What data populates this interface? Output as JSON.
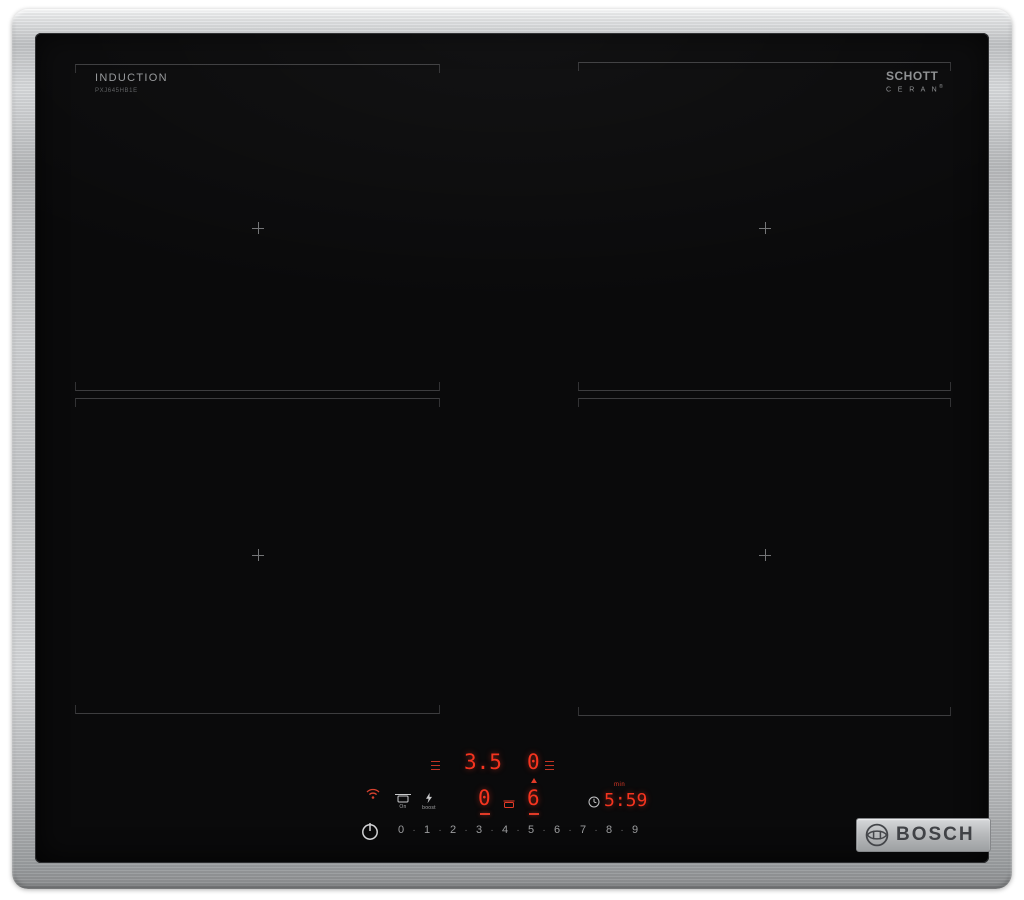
{
  "branding": {
    "induction": "INDUCTION",
    "model": "PXJ645HB1E",
    "schott_line1": "SCHOTT",
    "schott_line2": "C E R A N",
    "schott_reg": "®",
    "bosch": "BOSCH"
  },
  "display": {
    "rear_left_power": "3.5",
    "rear_right_power": "0",
    "front_left_power": "0",
    "front_right_power": "6",
    "timer_value": "5:59",
    "timer_unit": "min"
  },
  "controls": {
    "on_label": "On",
    "boost_label": "boost",
    "separator": "·",
    "levels": [
      "0",
      "1",
      "2",
      "3",
      "4",
      "5",
      "6",
      "7",
      "8",
      "9"
    ]
  },
  "colors": {
    "led_red": "#f5341f",
    "steel": "#c3c5c7",
    "glass_black": "#0a0a0b"
  }
}
